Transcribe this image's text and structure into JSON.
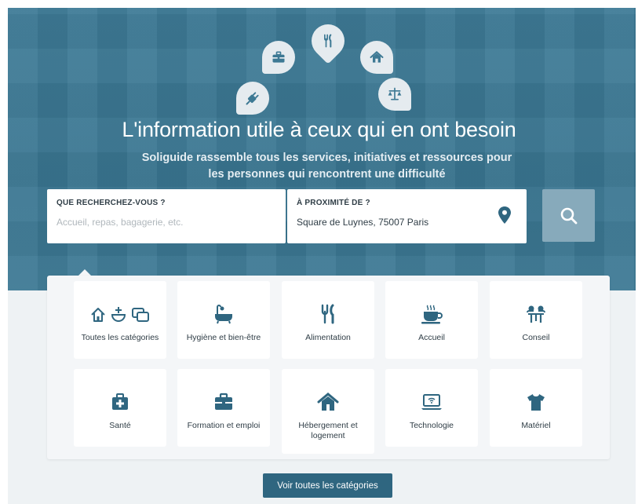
{
  "hero": {
    "title": "L'information utile à ceux qui en ont besoin",
    "subtitle_line1": "Soliguide rassemble tous les services, initiatives et ressources pour",
    "subtitle_line2": "les personnes qui rencontrent une difficulté",
    "pins": [
      "plug-icon",
      "briefcase-icon",
      "fork-knife-icon",
      "house-icon",
      "scales-icon"
    ]
  },
  "search": {
    "what_label": "QUE RECHERCHEZ-VOUS ?",
    "what_placeholder": "Accueil, repas, bagagerie, etc.",
    "where_label": "À PROXIMITÉ DE ?",
    "where_value": "Square de Luynes, 75007 Paris"
  },
  "categories": [
    {
      "label": "Toutes les catégories",
      "icon": "all-categories-icon"
    },
    {
      "label": "Hygiène et bien-être",
      "icon": "bathtub-icon"
    },
    {
      "label": "Alimentation",
      "icon": "fork-knife-icon"
    },
    {
      "label": "Accueil",
      "icon": "coffee-cup-icon"
    },
    {
      "label": "Conseil",
      "icon": "conversation-icon"
    },
    {
      "label": "Santé",
      "icon": "medical-kit-icon"
    },
    {
      "label": "Formation et emploi",
      "icon": "briefcase-icon"
    },
    {
      "label": "Hébergement et logement",
      "icon": "house-icon"
    },
    {
      "label": "Technologie",
      "icon": "laptop-wifi-icon"
    },
    {
      "label": "Matériel",
      "icon": "tshirt-icon"
    }
  ],
  "all_categories_button": "Voir toutes les catégories",
  "colors": {
    "hero_bg": "#3d7994",
    "accent_dark": "#2f6680",
    "search_button": "#87aabb",
    "text_dark": "#2f3d46"
  }
}
